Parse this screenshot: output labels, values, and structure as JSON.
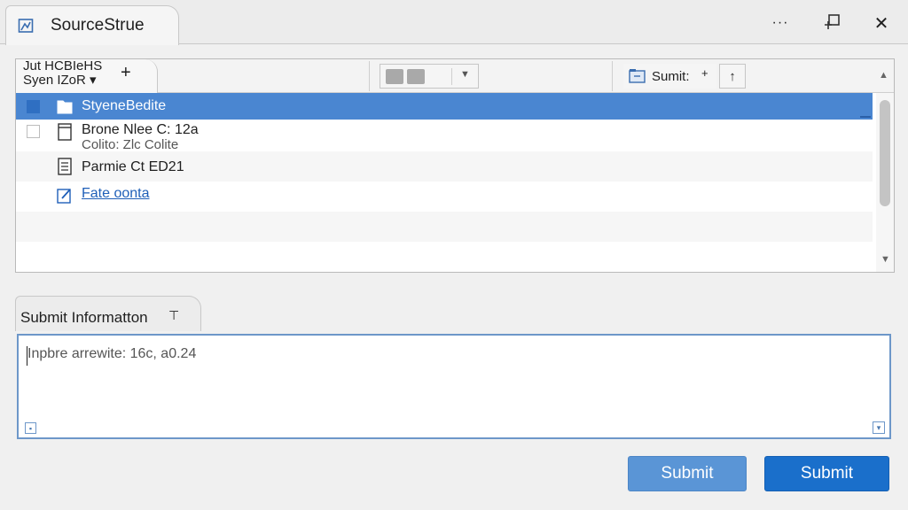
{
  "window": {
    "title": "SourceStrue",
    "more_glyph": "···",
    "close_glyph": "✕"
  },
  "toolbar": {
    "tab_line1": "Jut HCBIeHS",
    "tab_line2": "Syen IZoR ▾",
    "add_glyph": "+",
    "submit_label": "Sumit:",
    "submit_plus": "+",
    "up_glyph": "↑",
    "combo_arrow": "▼"
  },
  "list": {
    "rows": [
      {
        "label": "StyeneBedite",
        "selected": true
      },
      {
        "label": "Brone Nlee C: 12a",
        "sub": "Colito: Zlc Colite"
      },
      {
        "label": "Parmie Ct ED21"
      },
      {
        "label": "Fate oonta",
        "link": true
      }
    ],
    "scroll_up": "▲",
    "scroll_down": "▼"
  },
  "submit_section": {
    "tab_label": "Submit Informatton",
    "tab_arrow": "⊤",
    "input_value": "Inpbre arrewite: 16c, a0.24"
  },
  "buttons": {
    "submit_secondary": "Submit",
    "submit_primary": "Submit"
  },
  "colors": {
    "selection": "#4a86d1",
    "link": "#1f5fb8",
    "primary_button": "#1a6fcb",
    "secondary_button": "#5a95d6"
  }
}
